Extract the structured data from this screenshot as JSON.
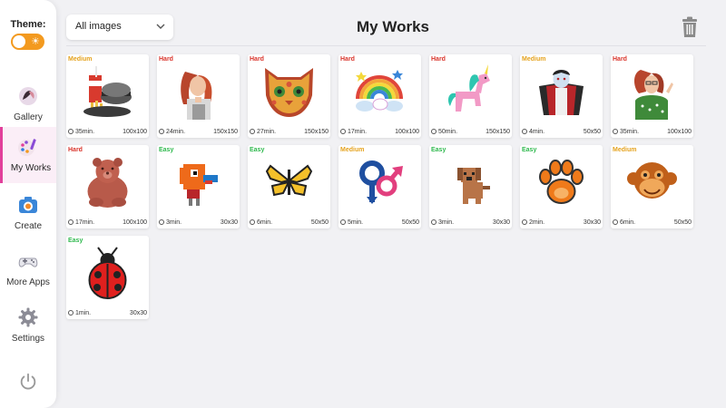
{
  "sidebar": {
    "theme_label": "Theme:",
    "theme_mode": "light",
    "items": [
      {
        "label": "Gallery",
        "icon": "gallery-icon",
        "active": false
      },
      {
        "label": "My Works",
        "icon": "palette-icon",
        "active": true
      },
      {
        "label": "Create",
        "icon": "camera-icon",
        "active": false
      },
      {
        "label": "More Apps",
        "icon": "gamepad-icon",
        "active": false
      },
      {
        "label": "Settings",
        "icon": "gear-icon",
        "active": false
      }
    ]
  },
  "header": {
    "filter_value": "All images",
    "title": "My Works"
  },
  "colors": {
    "accent": "#e23f9b",
    "toggle": "#f39a1f",
    "hard": "#d9332a",
    "medium": "#e5a21d",
    "easy": "#2db84c"
  },
  "works": [
    {
      "difficulty": "Medium",
      "time": "35min.",
      "size": "100x100",
      "subject": "soda-burger-fries"
    },
    {
      "difficulty": "Hard",
      "time": "24min.",
      "size": "150x150",
      "subject": "woman-portrait"
    },
    {
      "difficulty": "Hard",
      "time": "27min.",
      "size": "150x150",
      "subject": "ornate-cat"
    },
    {
      "difficulty": "Hard",
      "time": "17min.",
      "size": "100x100",
      "subject": "rainbow-unicorn"
    },
    {
      "difficulty": "Hard",
      "time": "50min.",
      "size": "150x150",
      "subject": "pink-unicorn"
    },
    {
      "difficulty": "Medium",
      "time": "4min.",
      "size": "50x50",
      "subject": "vampire"
    },
    {
      "difficulty": "Hard",
      "time": "35min.",
      "size": "100x100",
      "subject": "woman-polka-dot"
    },
    {
      "difficulty": "Hard",
      "time": "17min.",
      "size": "100x100",
      "subject": "brown-bear"
    },
    {
      "difficulty": "Easy",
      "time": "3min.",
      "size": "30x30",
      "subject": "orange-bird"
    },
    {
      "difficulty": "Easy",
      "time": "6min.",
      "size": "50x50",
      "subject": "butterfly"
    },
    {
      "difficulty": "Medium",
      "time": "5min.",
      "size": "50x50",
      "subject": "gender-symbols"
    },
    {
      "difficulty": "Easy",
      "time": "3min.",
      "size": "30x30",
      "subject": "dog"
    },
    {
      "difficulty": "Easy",
      "time": "2min.",
      "size": "30x30",
      "subject": "paw-print"
    },
    {
      "difficulty": "Medium",
      "time": "6min.",
      "size": "50x50",
      "subject": "monkey"
    },
    {
      "difficulty": "Easy",
      "time": "1min.",
      "size": "30x30",
      "subject": "ladybug"
    }
  ]
}
